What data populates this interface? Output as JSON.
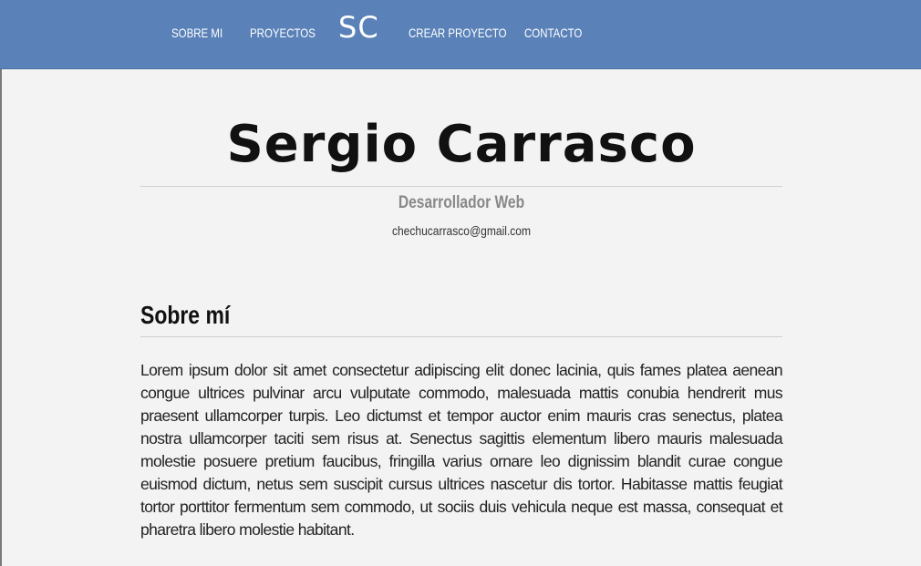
{
  "nav": {
    "items": [
      {
        "label": "SOBRE MI"
      },
      {
        "label": "PROYECTOS"
      },
      {
        "label": "CREAR PROYECTO"
      },
      {
        "label": "CONTACTO"
      }
    ],
    "logo": "SC"
  },
  "hero": {
    "name": "Sergio Carrasco",
    "role": "Desarrollador Web",
    "email": "chechucarrasco@gmail.com"
  },
  "about": {
    "title": "Sobre mí",
    "body": "Lorem ipsum dolor sit amet consectetur adipiscing elit donec lacinia, quis fames platea aenean congue ultrices pulvinar arcu vulputate commodo, malesuada mattis conubia hendrerit mus praesent ullamcorper turpis. Leo dictumst et tempor auctor enim mauris cras senectus, platea nostra ullamcorper taciti sem risus at. Senectus sagittis elementum libero mauris malesuada molestie posuere pretium faucibus, fringilla varius ornare leo dignissim blandit curae congue euismod dictum, netus sem suscipit cursus ultrices nascetur dis tortor. Habitasse mattis feugiat tortor porttitor fermentum sem commodo, ut sociis duis vehicula neque est massa, consequat et pharetra libero molestie habitant."
  },
  "colors": {
    "navbar": "#5a82b8",
    "background": "#f3f3f3",
    "text": "#222222",
    "muted": "#888888"
  }
}
